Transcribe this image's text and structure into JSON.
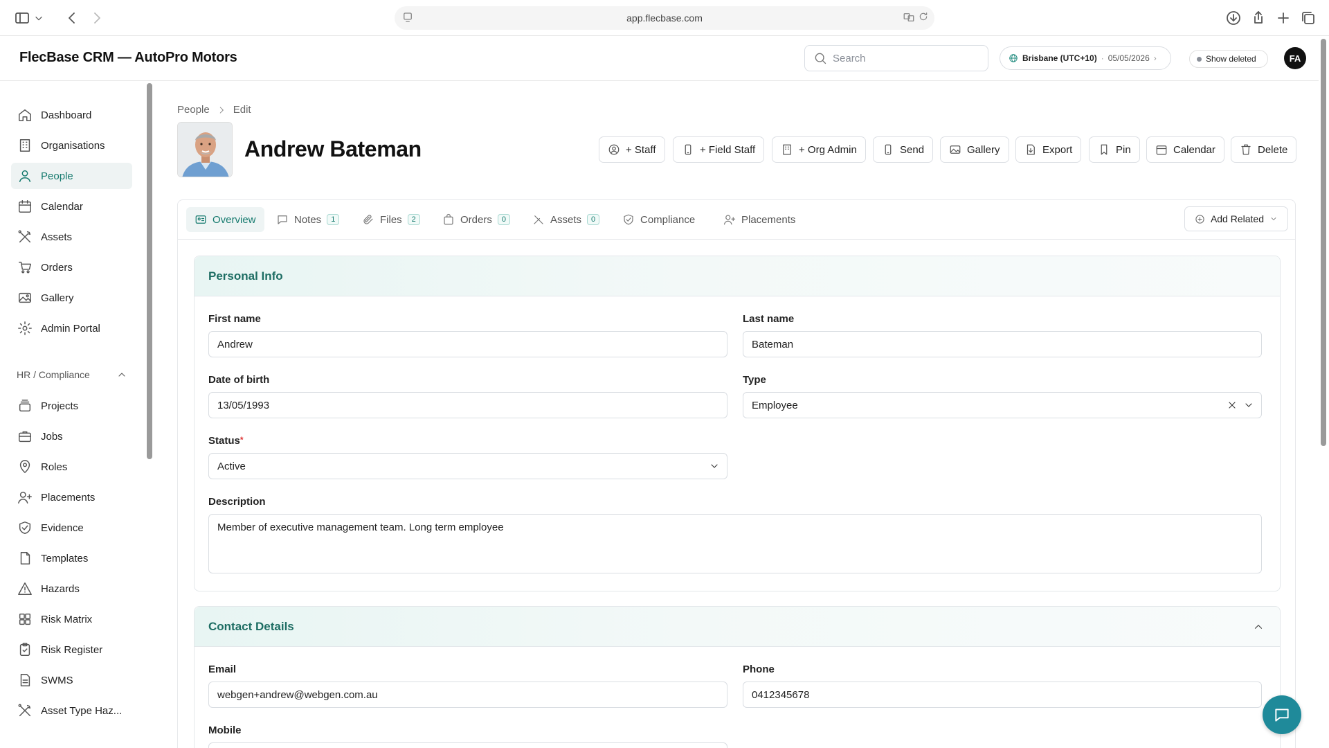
{
  "browser": {
    "url": "app.flecbase.com"
  },
  "header": {
    "app_title": "FlecBase CRM — AutoPro Motors",
    "search_placeholder": "Search",
    "timezone": "Brisbane (UTC+10)",
    "date": "05/05/2026",
    "show_deleted": "Show deleted",
    "avatar_initials": "FA"
  },
  "sidebar": {
    "items": [
      {
        "label": "Dashboard",
        "icon": "home-icon"
      },
      {
        "label": "Organisations",
        "icon": "building-icon"
      },
      {
        "label": "People",
        "icon": "person-icon",
        "active": true
      },
      {
        "label": "Calendar",
        "icon": "calendar-icon"
      },
      {
        "label": "Assets",
        "icon": "tools-icon"
      },
      {
        "label": "Orders",
        "icon": "cart-icon"
      },
      {
        "label": "Gallery",
        "icon": "image-icon"
      },
      {
        "label": "Admin Portal",
        "icon": "gear-icon"
      }
    ],
    "group_label": "HR / Compliance",
    "group_items": [
      {
        "label": "Projects",
        "icon": "stack-icon"
      },
      {
        "label": "Jobs",
        "icon": "briefcase-icon"
      },
      {
        "label": "Roles",
        "icon": "badge-icon"
      },
      {
        "label": "Placements",
        "icon": "user-plus-icon"
      },
      {
        "label": "Evidence",
        "icon": "shield-check-icon"
      },
      {
        "label": "Templates",
        "icon": "file-icon"
      },
      {
        "label": "Hazards",
        "icon": "warning-icon"
      },
      {
        "label": "Risk Matrix",
        "icon": "grid-icon"
      },
      {
        "label": "Risk Register",
        "icon": "clipboard-icon"
      },
      {
        "label": "SWMS",
        "icon": "document-icon"
      },
      {
        "label": "Asset Type Haz...",
        "icon": "tools-icon"
      }
    ]
  },
  "breadcrumb": {
    "parent": "People",
    "current": "Edit"
  },
  "person": {
    "name": "Andrew Bateman"
  },
  "actions": [
    {
      "label": "+ Staff",
      "icon": "user-circle-icon"
    },
    {
      "label": "+ Field Staff",
      "icon": "mobile-icon"
    },
    {
      "label": "+ Org Admin",
      "icon": "building-icon"
    },
    {
      "label": "Send",
      "icon": "mobile-icon"
    },
    {
      "label": "Gallery",
      "icon": "image-icon"
    },
    {
      "label": "Export",
      "icon": "file-export-icon"
    },
    {
      "label": "Pin",
      "icon": "bookmark-icon"
    },
    {
      "label": "Calendar",
      "icon": "calendar-icon"
    },
    {
      "label": "Delete",
      "icon": "trash-icon"
    }
  ],
  "tabs": [
    {
      "label": "Overview",
      "icon": "id-card-icon",
      "count": null,
      "active": true
    },
    {
      "label": "Notes",
      "icon": "chat-icon",
      "count": "1"
    },
    {
      "label": "Files",
      "icon": "paperclip-icon",
      "count": "2"
    },
    {
      "label": "Orders",
      "icon": "bag-icon",
      "count": "0"
    },
    {
      "label": "Assets",
      "icon": "tools-icon",
      "count": "0"
    },
    {
      "label": "Compliance",
      "icon": "shield-check-icon",
      "count": null
    },
    {
      "label": "Placements",
      "icon": "user-plus-icon",
      "count": null
    }
  ],
  "add_related": "Add Related",
  "personal_info": {
    "title": "Personal Info",
    "first_name_label": "First name",
    "first_name": "Andrew",
    "last_name_label": "Last name",
    "last_name": "Bateman",
    "dob_label": "Date of birth",
    "dob": "13/05/1993",
    "type_label": "Type",
    "type": "Employee",
    "status_label": "Status",
    "status_required": "*",
    "status": "Active",
    "description_label": "Description",
    "description": "Member of executive management team. Long term employee"
  },
  "contact_details": {
    "title": "Contact Details",
    "email_label": "Email",
    "email": "webgen+andrew@webgen.com.au",
    "phone_label": "Phone",
    "phone": "0412345678",
    "mobile_label": "Mobile"
  }
}
